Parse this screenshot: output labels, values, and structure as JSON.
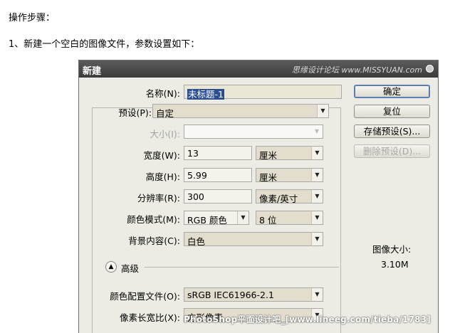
{
  "article": {
    "steps_heading": "操作步骤：",
    "step1": "1、新建一个空白的图像文件，参数设置如下："
  },
  "dialog": {
    "title": "新建",
    "watermark_text": "思缘设计论坛 www.MISSYUAN.com",
    "name": {
      "label": "名称(N):",
      "value": "未标题-1"
    },
    "preset": {
      "label": "预设(P):",
      "value": "自定"
    },
    "size": {
      "label": "大小(I):",
      "value": ""
    },
    "width": {
      "label": "宽度(W):",
      "value": "13",
      "unit": "厘米"
    },
    "height": {
      "label": "高度(H):",
      "value": "5.99",
      "unit": "厘米"
    },
    "resolution": {
      "label": "分辨率(R):",
      "value": "300",
      "unit": "像素/英寸"
    },
    "color_mode": {
      "label": "颜色模式(M):",
      "value": "RGB 颜色",
      "depth": "8 位"
    },
    "background": {
      "label": "背景内容(C):",
      "value": "白色"
    },
    "advanced": {
      "toggle_icon": "chevron-up",
      "label": "高级"
    },
    "color_profile": {
      "label": "颜色配置文件(O):",
      "value": "sRGB IEC61966-2.1"
    },
    "pixel_aspect": {
      "label": "像素长宽比(X):",
      "value": "方形像素"
    },
    "buttons": {
      "ok": "确定",
      "reset": "复位",
      "save_preset": "存储预设(S)...",
      "delete_preset": "删除预设(D)..."
    },
    "image_size": {
      "title": "图像大小:",
      "value": "3.10M"
    }
  },
  "overlay_watermark": "PhotoShop平面设计吧_[www.lineeg.com/tieba/1783]"
}
